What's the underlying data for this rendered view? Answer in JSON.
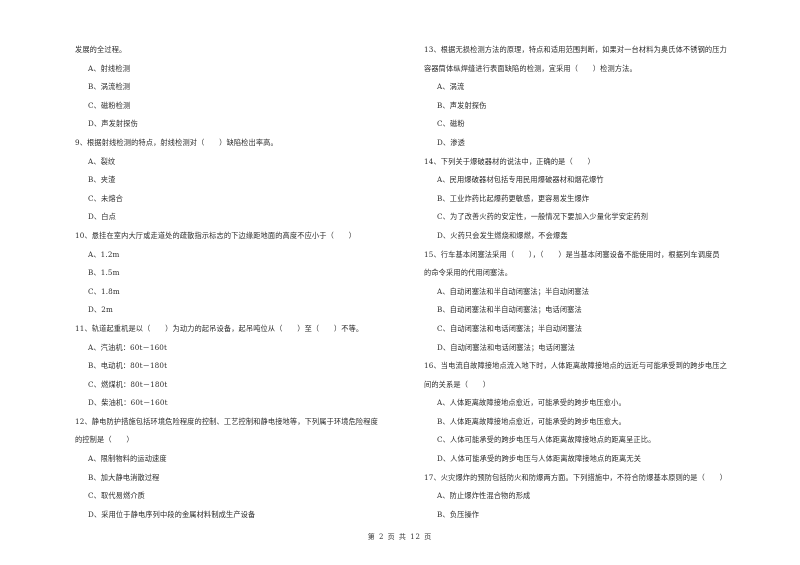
{
  "left_column": [
    {
      "type": "continuation",
      "text": "发展的全过程。"
    },
    {
      "type": "option",
      "text": "A、射线检测"
    },
    {
      "type": "option",
      "text": "B、涡流检测"
    },
    {
      "type": "option",
      "text": "C、磁粉检测"
    },
    {
      "type": "option",
      "text": "D、声发射探伤"
    },
    {
      "type": "question",
      "text": "9、根据射线检测的特点，射线检测对（　　）缺陷检出率高。"
    },
    {
      "type": "option",
      "text": "A、裂纹"
    },
    {
      "type": "option",
      "text": "B、夹渣"
    },
    {
      "type": "option",
      "text": "C、未熔合"
    },
    {
      "type": "option",
      "text": "D、白点"
    },
    {
      "type": "question",
      "text": "10、悬挂在室内大厅或走道处的疏散指示标志的下边缘距地面的高度不应小于（　　）"
    },
    {
      "type": "option",
      "text": "A、1.2m"
    },
    {
      "type": "option",
      "text": "B、1.5m"
    },
    {
      "type": "option",
      "text": "C、1.8m"
    },
    {
      "type": "option",
      "text": "D、2m"
    },
    {
      "type": "question",
      "text": "11、轨道起重机是以（　　）为动力的起吊设备，起吊吨位从（　　）至（　　）不等。"
    },
    {
      "type": "option",
      "text": "A、汽油机：60t－160t"
    },
    {
      "type": "option",
      "text": "B、电动机：80t－180t"
    },
    {
      "type": "option",
      "text": "C、燃煤机：80t－180t"
    },
    {
      "type": "option",
      "text": "D、柴油机：60t－160t"
    },
    {
      "type": "question",
      "text": "12、静电防护措施包括环境危险程度的控制、工艺控制和静电接地等，下列属于环境危险程度"
    },
    {
      "type": "continuation",
      "text": "的控制是（　　）"
    },
    {
      "type": "option",
      "text": "A、限制物料的运动速度"
    },
    {
      "type": "option",
      "text": "B、加大静电消散过程"
    },
    {
      "type": "option",
      "text": "C、取代易燃介质"
    },
    {
      "type": "option",
      "text": "D、采用位于静电序列中段的金属材料制成生产设备"
    }
  ],
  "right_column": [
    {
      "type": "question",
      "text": "13、根据无损检测方法的原理，特点和适用范围判断，如果对一台材料为奥氏体不锈钢的压力"
    },
    {
      "type": "continuation",
      "text": "容器筒体纵焊缝进行表面缺陷的检测，宜采用（　　）检测方法。"
    },
    {
      "type": "option",
      "text": "A、涡流"
    },
    {
      "type": "option",
      "text": "B、声发射探伤"
    },
    {
      "type": "option",
      "text": "C、磁粉"
    },
    {
      "type": "option",
      "text": "D、渗透"
    },
    {
      "type": "question",
      "text": "14、下列关于爆破器材的说法中，正确的是（　　）"
    },
    {
      "type": "option",
      "text": "A、民用爆破器材包括专用民用爆破器材和烟花爆竹"
    },
    {
      "type": "option",
      "text": "B、工业炸药比起爆药更敏感，更容易发生爆炸"
    },
    {
      "type": "option",
      "text": "C、为了改善火药的安定性，一般情况下要加入少量化学安定药剂"
    },
    {
      "type": "option",
      "text": "D、火药只会发生燃烧和爆燃，不会爆轰"
    },
    {
      "type": "question",
      "text": "15、行车基本闭塞法采用（　　），（　　）是当基本闭塞设备不能使用时，根据列车调度员"
    },
    {
      "type": "continuation",
      "text": "的命令采用的代用闭塞法。"
    },
    {
      "type": "option",
      "text": "A、自动闭塞法和半自动闭塞法；半自动闭塞法"
    },
    {
      "type": "option",
      "text": "B、自动闭塞法和半自动闭塞法；电话闭塞法"
    },
    {
      "type": "option",
      "text": "C、自动闭塞法和电话闭塞法；半自动闭塞法"
    },
    {
      "type": "option",
      "text": "D、自动闭塞法和电话闭塞法；电话闭塞法"
    },
    {
      "type": "question",
      "text": "16、当电流自故障接地点流入地下时，人体距离故障接地点的远近与可能承受到的跨步电压之"
    },
    {
      "type": "continuation",
      "text": "间的关系是（　　）"
    },
    {
      "type": "option",
      "text": "A、人体距离故障接地点愈近，可能承受的跨步电压愈小。"
    },
    {
      "type": "option",
      "text": "B、人体距离故障接地点愈近，可能承受的跨步电压愈大。"
    },
    {
      "type": "option",
      "text": "C、人体可能承受的跨步电压与人体距离故障接地点的距离呈正比。"
    },
    {
      "type": "option",
      "text": "D、人体可能承受的跨步电压与人体距离故障接地点的距离无关"
    },
    {
      "type": "question",
      "text": "17、火灾爆炸的预防包括防火和防爆两方面。下列措施中，不符合防爆基本原则的是（　　）"
    },
    {
      "type": "option",
      "text": "A、防止爆炸性混合物的形成"
    },
    {
      "type": "option",
      "text": "B、负压操作"
    }
  ],
  "footer": {
    "page_label": "第 2 页 共 12 页"
  }
}
